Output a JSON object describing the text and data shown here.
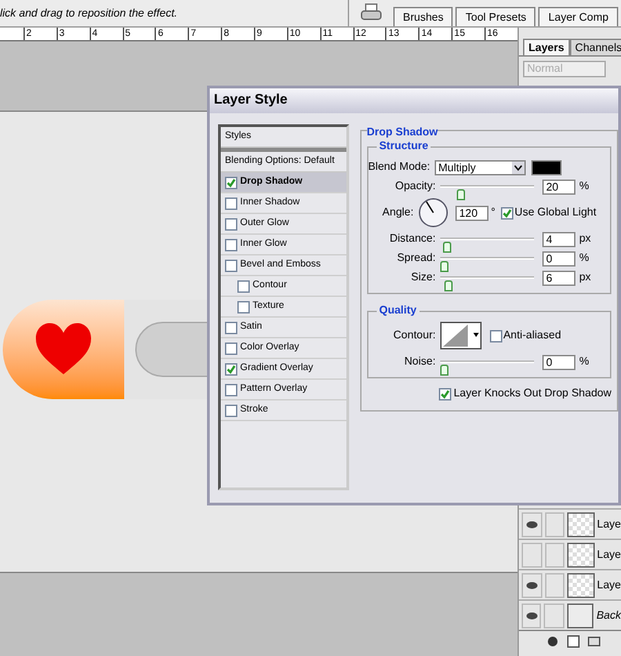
{
  "options_bar": {
    "hint": "lick and drag to reposition the effect."
  },
  "palette_tabs": [
    {
      "label": "Brushes"
    },
    {
      "label": "Tool Presets"
    },
    {
      "label": "Layer Comp"
    }
  ],
  "ruler": {
    "marks": [
      "2",
      "3",
      "4",
      "5",
      "6",
      "7",
      "8",
      "9",
      "10",
      "11",
      "12",
      "13",
      "14",
      "15",
      "16"
    ]
  },
  "layers_panel": {
    "tabs": [
      {
        "label": "Layers",
        "selected": true
      },
      {
        "label": "Channels",
        "selected": false
      }
    ],
    "blend_mode": {
      "value": "Normal",
      "disabled": true
    },
    "layers": [
      {
        "name": "Laye",
        "kind": "layer",
        "visible": true
      },
      {
        "name": "Laye",
        "kind": "layer",
        "visible": false
      },
      {
        "name": "Laye",
        "kind": "layer",
        "visible": true
      },
      {
        "name": "Back",
        "kind": "background",
        "visible": true
      }
    ]
  },
  "dialog": {
    "title": "Layer Style",
    "styles": [
      {
        "label": "Styles",
        "kind": "header",
        "selected": false
      },
      {
        "label": "Blending Options: Default",
        "kind": "header",
        "selected": false
      },
      {
        "label": "Drop Shadow",
        "kind": "effect",
        "checked": true,
        "selected": true
      },
      {
        "label": "Inner Shadow",
        "kind": "effect",
        "checked": false,
        "selected": false
      },
      {
        "label": "Outer Glow",
        "kind": "effect",
        "checked": false,
        "selected": false
      },
      {
        "label": "Inner Glow",
        "kind": "effect",
        "checked": false,
        "selected": false
      },
      {
        "label": "Bevel and Emboss",
        "kind": "effect",
        "checked": false,
        "selected": false,
        "children": [
          {
            "label": "Contour",
            "kind": "effect",
            "checked": false,
            "selected": false
          },
          {
            "label": "Texture",
            "kind": "effect",
            "checked": false,
            "selected": false
          }
        ]
      },
      {
        "label": "Satin",
        "kind": "effect",
        "checked": false,
        "selected": false
      },
      {
        "label": "Color Overlay",
        "kind": "effect",
        "checked": false,
        "selected": false
      },
      {
        "label": "Gradient Overlay",
        "kind": "effect",
        "checked": true,
        "selected": false
      },
      {
        "label": "Pattern Overlay",
        "kind": "effect",
        "checked": false,
        "selected": false
      },
      {
        "label": "Stroke",
        "kind": "effect",
        "checked": false,
        "selected": false
      }
    ],
    "panel_title": "Drop Shadow",
    "structure": {
      "title": "Structure",
      "blend_mode": {
        "label": "Blend Mode:",
        "value": "Multiply",
        "color": "#000000"
      },
      "opacity": {
        "label": "Opacity:",
        "value": "20",
        "unit": "%",
        "level": 0.2
      },
      "angle": {
        "label": "Angle:",
        "value": "120",
        "unit": "°",
        "global_light": {
          "label": "Use Global Light",
          "checked": true
        }
      },
      "distance": {
        "label": "Distance:",
        "value": "4",
        "unit": "px",
        "level": 0.04
      },
      "spread": {
        "label": "Spread:",
        "value": "0",
        "unit": "%",
        "level": 0
      },
      "size": {
        "label": "Size:",
        "value": "6",
        "unit": "px",
        "level": 0.06
      }
    },
    "quality": {
      "title": "Quality",
      "contour": {
        "label": "Contour:"
      },
      "anti_aliased": {
        "label": "Anti-aliased",
        "checked": false
      },
      "noise": {
        "label": "Noise:",
        "value": "0",
        "unit": "%",
        "level": 0
      }
    },
    "knockout": {
      "label": "Layer Knocks Out Drop Shadow",
      "checked": true
    }
  }
}
